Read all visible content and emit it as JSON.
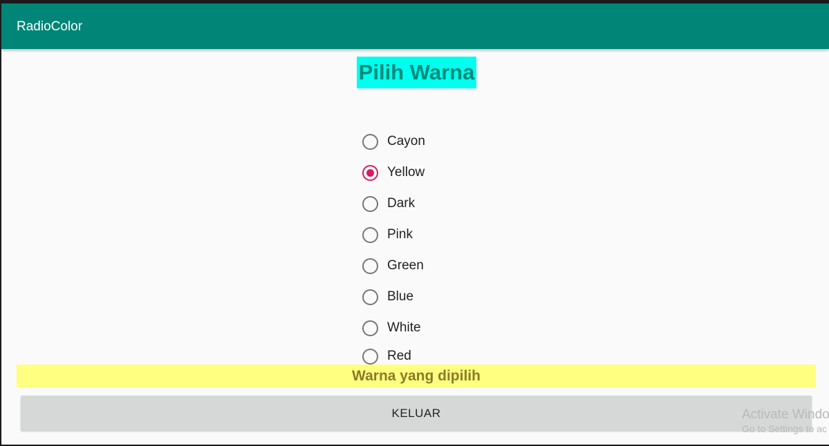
{
  "app": {
    "title": "RadioColor",
    "accent_color": "#008577",
    "radio_checked_color": "#d81b60"
  },
  "heading": {
    "text": "Pilih Warna",
    "background": "#00ffee"
  },
  "radio_group": {
    "selected": "Yellow",
    "options": [
      {
        "label": "Cayon",
        "checked": false
      },
      {
        "label": "Yellow",
        "checked": true
      },
      {
        "label": "Dark",
        "checked": false
      },
      {
        "label": "Pink",
        "checked": false
      },
      {
        "label": "Green",
        "checked": false
      },
      {
        "label": "Blue",
        "checked": false
      },
      {
        "label": "White",
        "checked": false
      },
      {
        "label": "Red",
        "checked": false
      }
    ]
  },
  "result": {
    "text": "Warna yang dipilih",
    "background": "#ffff80"
  },
  "exit_button": {
    "label": "KELUAR"
  },
  "os_watermark": {
    "line1": "Activate Windo",
    "line2": "Go to Settings to ac"
  }
}
